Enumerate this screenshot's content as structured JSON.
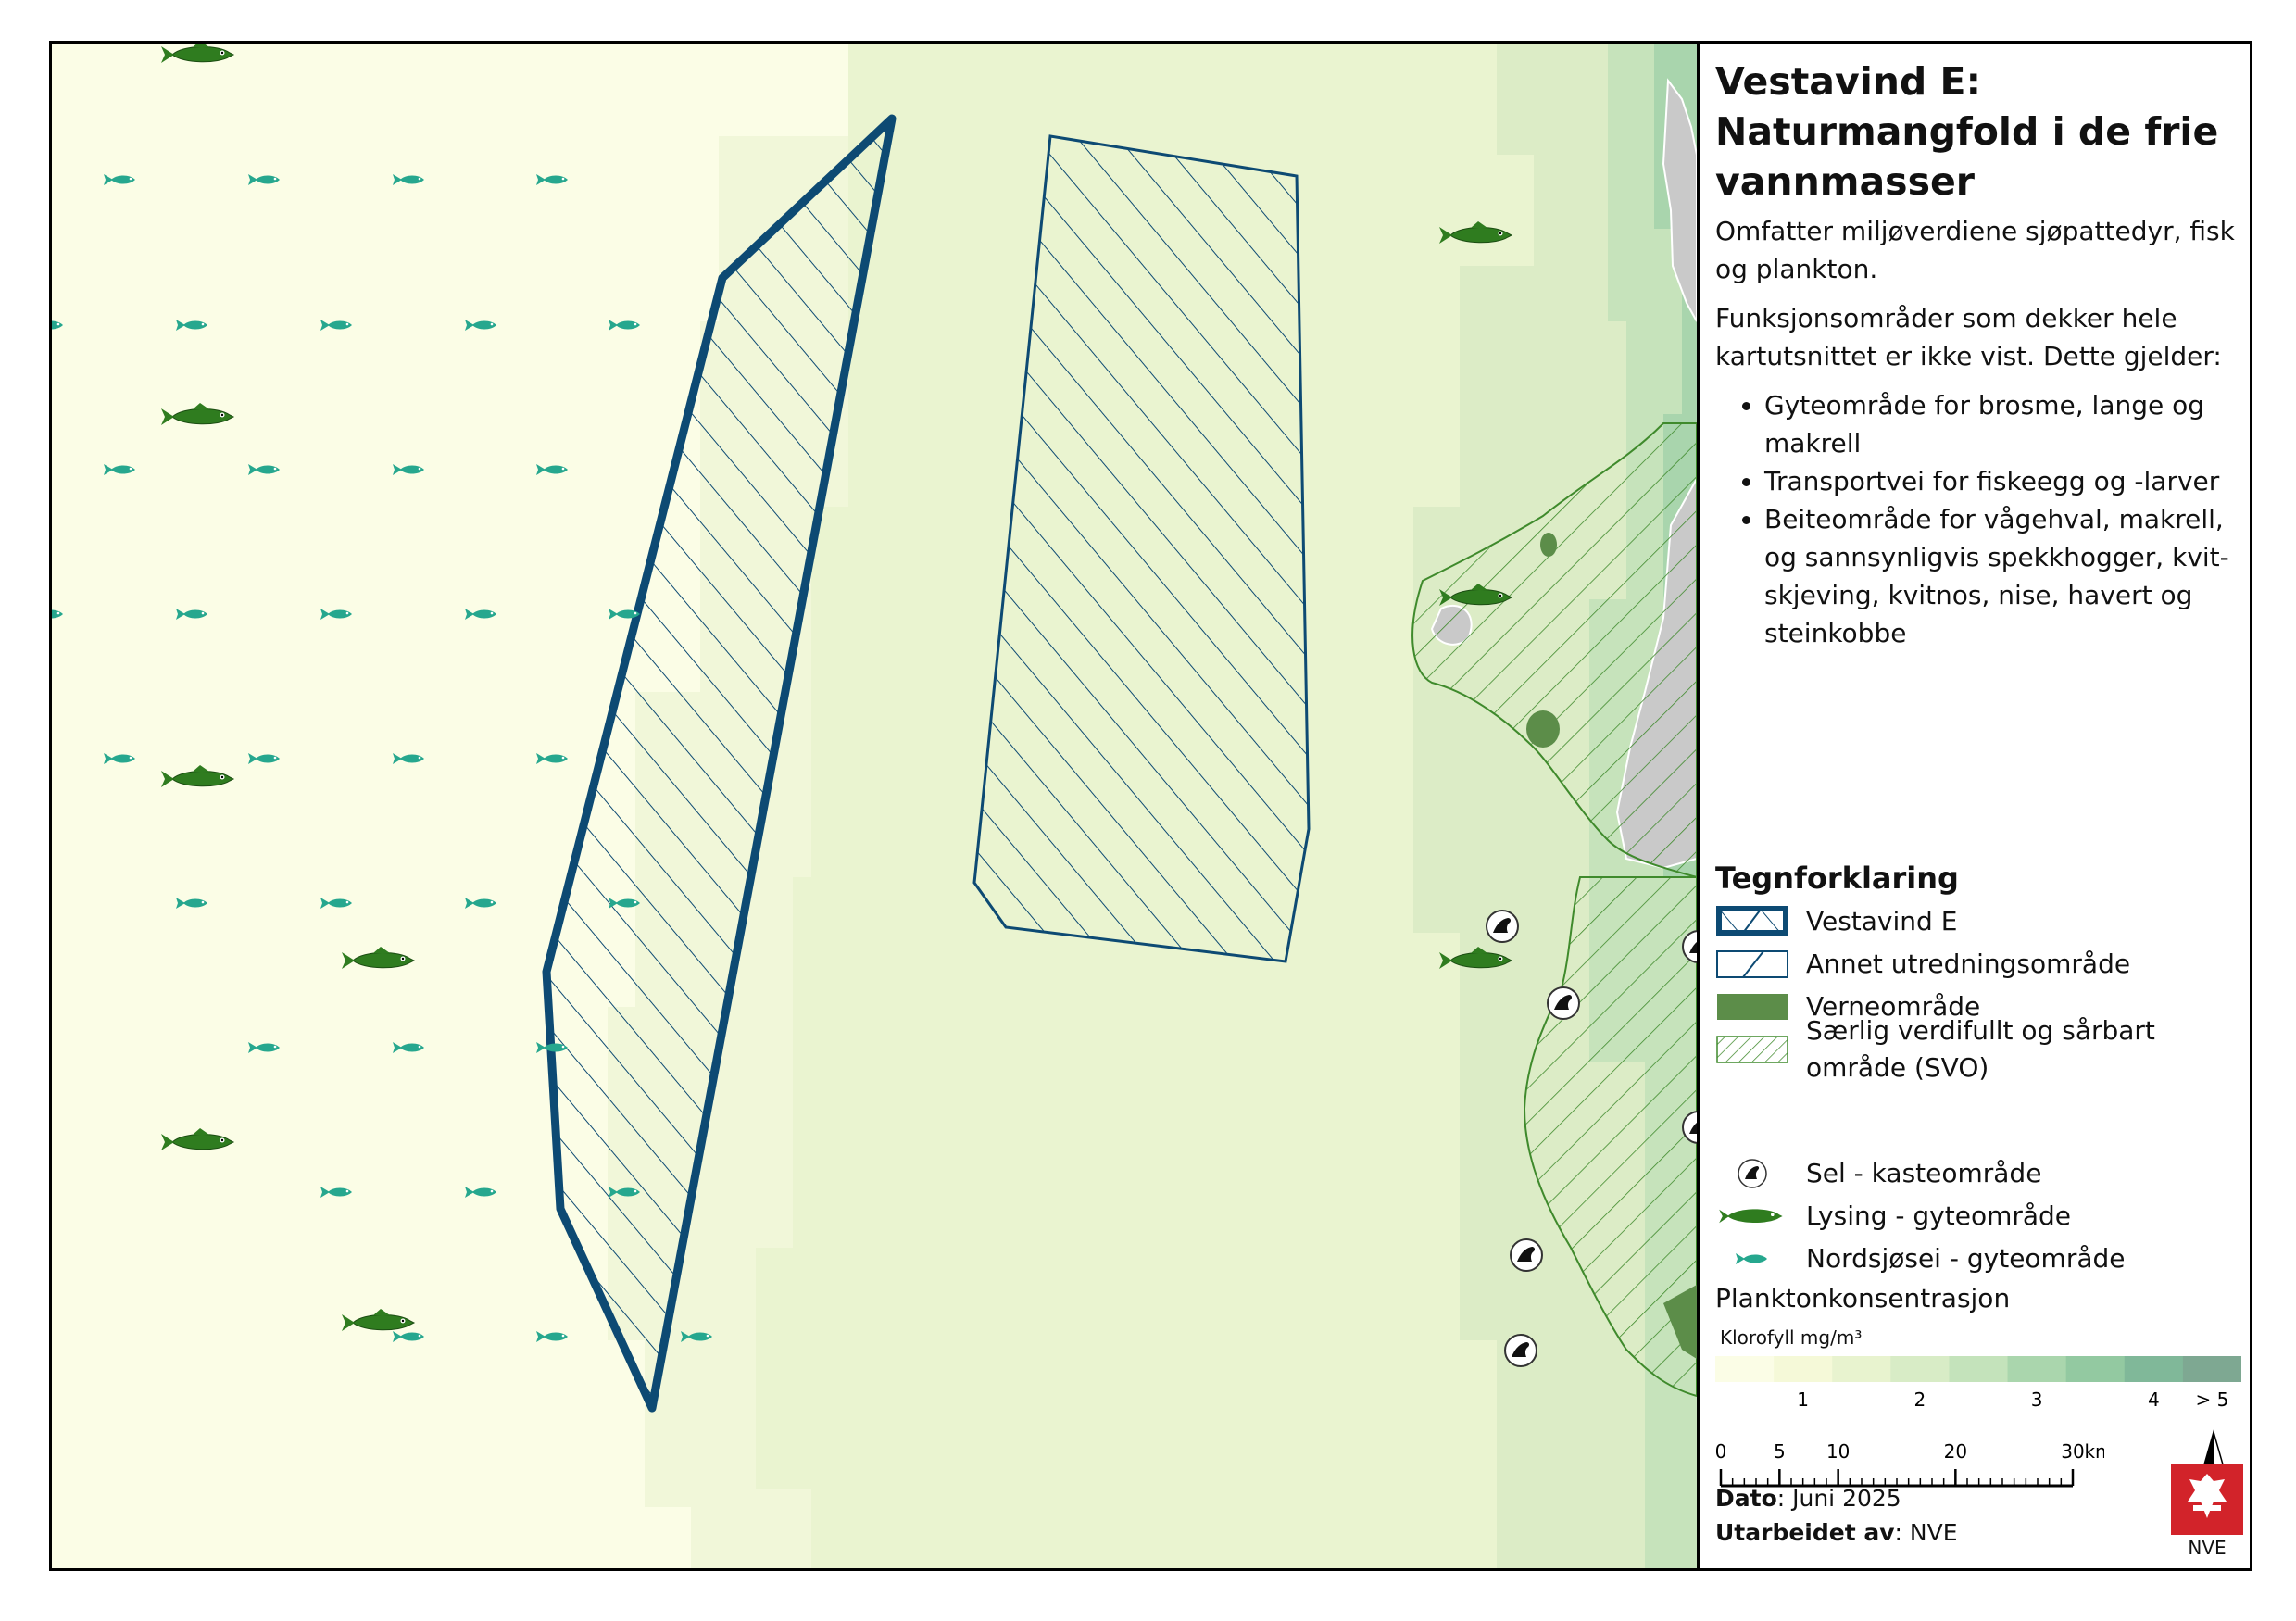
{
  "title_lines": [
    "Vestavind E:",
    "Naturmangfold i de frie",
    "vannmasser"
  ],
  "description": {
    "p1": "Omfatter miljøverdiene sjøpattedyr, fisk og plankton.",
    "p2": "Funksjonsområder som dekker hele kartutsnittet er ikke vist. Dette gjelder:",
    "items": [
      "Gyteområde for brosme, lange og makrell",
      "Transportvei for fiskeegg og -larver",
      "Beiteområde for vågehval, makrell, og sannsynligvis spekkhogger, kvit-skjeving, kvitnos, nise, havert og steinkobbe"
    ]
  },
  "legend": {
    "title": "Tegnforklaring",
    "items": [
      {
        "label": "Vestavind E",
        "icon": "hatched-thick-outline"
      },
      {
        "label": "Annet utredningsområde",
        "icon": "hatched-thin-outline"
      },
      {
        "label": "Verneområde",
        "icon": "solid-green-fill"
      },
      {
        "label": "Særlig verdifullt og sårbart område (SVO)",
        "icon": "green-hatch"
      },
      {
        "label": "Sel - kasteområde",
        "icon": "seal-icon"
      },
      {
        "label": "Lysing - gyteområde",
        "icon": "hake-fish-icon"
      },
      {
        "label": "Nordsjøsei - gyteområde",
        "icon": "saithe-fish-icon"
      }
    ]
  },
  "plankton": {
    "title": "Planktonkonsentrasjon",
    "unit": "Klorofyll mg/m³",
    "ticks": [
      "1",
      "2",
      "3",
      "4",
      "> 5"
    ],
    "colors": [
      "#fbfde6",
      "#f5f9d8",
      "#e8f3cf",
      "#d8ecc6",
      "#c4e3bb",
      "#aad6ad",
      "#93c9a1",
      "#80b899",
      "#7ea892"
    ]
  },
  "scalebar": {
    "ticks": [
      "0",
      "5",
      "10",
      "20",
      "30"
    ],
    "unit": "km"
  },
  "north": "N",
  "credits": {
    "date_label": "Dato",
    "date_value": ": Juni 2025",
    "author_label": "Utarbeidet av",
    "author_value": ": NVE"
  },
  "logo": {
    "text": "NVE",
    "color": "#d2232a"
  },
  "colors": {
    "vestavind": "#0d4a73",
    "svo": "#3f8a2c",
    "verne": "#5c8d49",
    "sei_fish": "#26a78e",
    "lysing_fish": "#2f7c1f",
    "land": "#c9c9c9"
  }
}
